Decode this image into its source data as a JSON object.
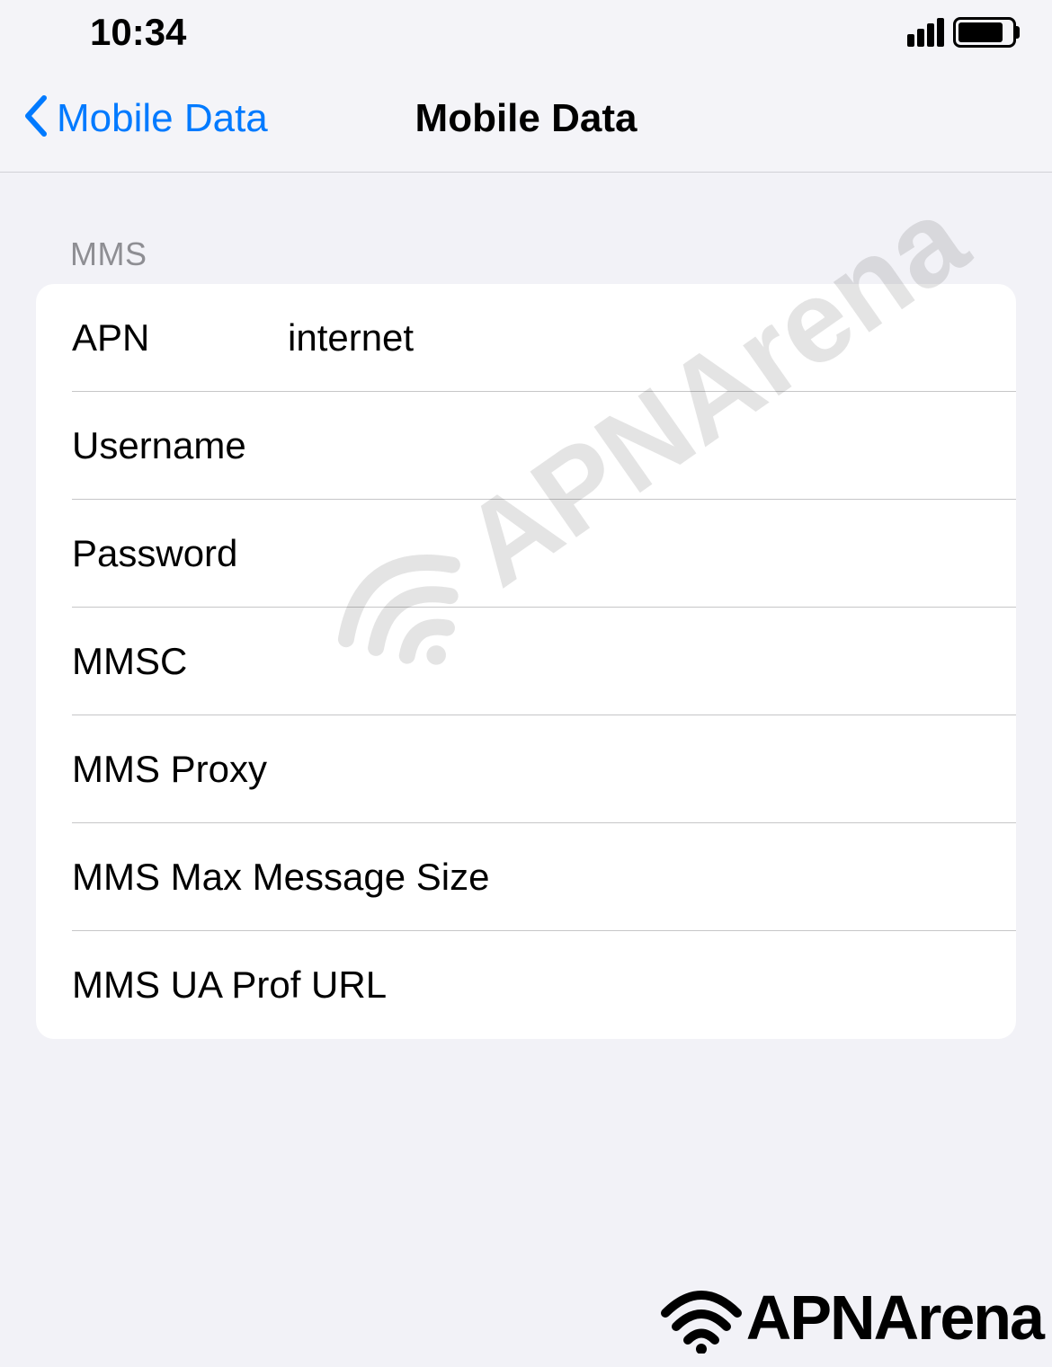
{
  "status_bar": {
    "time": "10:34"
  },
  "nav": {
    "back_label": "Mobile Data",
    "title": "Mobile Data"
  },
  "section": {
    "header": "MMS",
    "rows": [
      {
        "label": "APN",
        "value": "internet"
      },
      {
        "label": "Username",
        "value": ""
      },
      {
        "label": "Password",
        "value": ""
      },
      {
        "label": "MMSC",
        "value": ""
      },
      {
        "label": "MMS Proxy",
        "value": ""
      },
      {
        "label": "MMS Max Message Size",
        "value": ""
      },
      {
        "label": "MMS UA Prof URL",
        "value": ""
      }
    ]
  },
  "watermark": "APNArena",
  "footer_logo": "APNArena"
}
